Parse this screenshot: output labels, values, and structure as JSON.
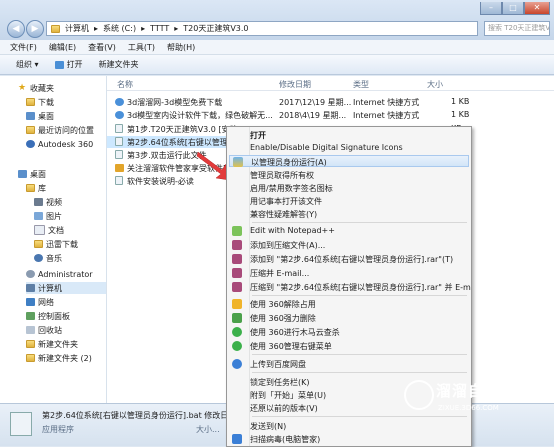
{
  "address": {
    "segments": [
      "计算机",
      "系统 (C:)",
      "TTTT",
      "T20天正建筑V3.0"
    ],
    "search_placeholder": "搜索 T20天正建筑V3.0"
  },
  "window_controls": {
    "minimize": "–",
    "maximize": "□",
    "close": "✕"
  },
  "menubar": [
    "文件(F)",
    "编辑(E)",
    "查看(V)",
    "工具(T)",
    "帮助(H)"
  ],
  "toolbar": {
    "organize": "组织 ▾",
    "open": "打开",
    "new_folder": "新建文件夹"
  },
  "nav": {
    "favorites": "收藏夹",
    "downloads": "下载",
    "desktop": "桌面",
    "recent": "最近访问的位置",
    "autodesk": "Autodesk 360",
    "desktop2": "桌面",
    "libraries": "库",
    "videos": "视频",
    "pictures": "图片",
    "documents": "文档",
    "thunder": "迅雷下载",
    "music": "音乐",
    "admin": "Administrator",
    "computer": "计算机",
    "network": "网络",
    "control_panel": "控制面板",
    "recycle": "回收站",
    "new_folder": "新建文件夹",
    "new_folder2": "新建文件夹 (2)"
  },
  "columns": {
    "name": "名称",
    "date": "修改日期",
    "type": "类型",
    "size": "大小"
  },
  "files": [
    {
      "name": "3d溜溜网-3d模型免费下载",
      "date": "2017\\12\\19 星期...",
      "type": "Internet 快捷方式",
      "size": "1 KB"
    },
    {
      "name": "3d模型室内设计软件下载，绿色破解无...",
      "date": "2018\\4\\19 星期...",
      "type": "Internet 快捷方式",
      "size": "1 KB"
    },
    {
      "name": "第1步.T20天正建筑V3.0 [安装...",
      "date": "",
      "type": "",
      "size": "KB"
    },
    {
      "name": "第2步.64位系统[右键以管理员...",
      "date": "",
      "type": "",
      "size": "KB"
    },
    {
      "name": "第3步.双击运行此文件",
      "date": "",
      "type": "",
      "size": "KB"
    },
    {
      "name": "关注溜溜软件管家享受软件安装...",
      "date": "",
      "type": "",
      "size": "KB"
    },
    {
      "name": "软件安装说明-必读",
      "date": "",
      "type": "",
      "size": "KB"
    }
  ],
  "context_menu": {
    "open": "打开",
    "digital_sig": "Enable/Disable Digital Signature Icons",
    "run_as_admin": "以管理员身份运行(A)",
    "take_ownership": "管理员取得所有权",
    "toggle_digital_icon": "启用/禁用数字签名图标",
    "notepad_open": "用记事本打开该文件",
    "compat": "兼容性疑难解答(Y)",
    "notepadpp": "Edit with Notepad++",
    "add_archive": "添加到压缩文件(A)...",
    "add_rar": "添加到 \"第2步.64位系统[右键以管理员身份运行].rar\"(T)",
    "compress_email": "压缩并 E-mail...",
    "compress_rar_email": "压缩到 \"第2步.64位系统[右键以管理员身份运行].rar\" 并 E-mail",
    "unlock360": "使用 360解除占用",
    "shred360": "使用 360强力删除",
    "scan360": "使用 360进行木马云查杀",
    "menu360": "使用 360管理右键菜单",
    "baidu": "上传到百度网盘",
    "pin_taskbar": "锁定到任务栏(K)",
    "pin_start": "附到「开始」菜单(U)",
    "restore": "还原以前的版本(V)",
    "send_to": "发送到(N)",
    "scan_more": "扫描病毒(电脑管家)"
  },
  "status": {
    "filename": "第2步.64位系统[右键以管理员身份运行].bat 修改日",
    "type": "应用程序",
    "size": "大小..."
  },
  "watermark": {
    "title": "溜溜自学",
    "url": "ZIXUE.3D66.COM"
  },
  "colors": {
    "highlight": "#cde8ff",
    "menu_highlight": "#d2e5f8",
    "arrow": "#e23b3b"
  }
}
